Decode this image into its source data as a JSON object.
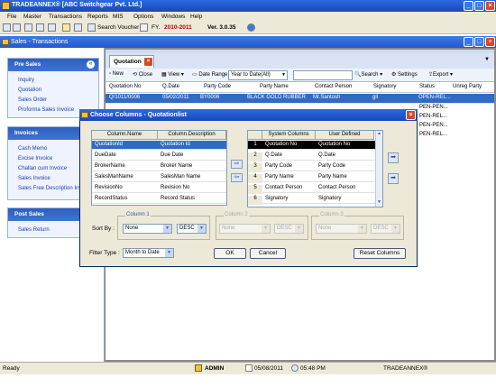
{
  "app": {
    "title": "TRADEANNEX® [ABC Switchgear Pvt. Ltd.]",
    "menu": [
      "File",
      "Master",
      "Transactions",
      "Reports",
      "MIS",
      "Options",
      "Windows",
      "Help"
    ],
    "toolbar": {
      "search_voucher": "Search Voucher",
      "fy": "FY.",
      "fy_value": "2010-2011",
      "version": "Ver. 3.0.35"
    }
  },
  "inner_window": {
    "title": "Sales - Transactions"
  },
  "sidebar": {
    "pre_sales": {
      "header": "Pre Sales",
      "items": [
        "Inquiry",
        "Quotation",
        "Sales Order",
        "Proforma Sales Invoice"
      ]
    },
    "invoices": {
      "header": "Invoices",
      "items": [
        "Cash Memo",
        "Excise Invoice",
        "Challan cum Invoice",
        "Sales Invoice",
        "Sales Free Description Inv"
      ]
    },
    "post_sales": {
      "header": "Post Sales",
      "items": [
        "Sales Return"
      ]
    }
  },
  "quotation": {
    "tab_label": "Quotation",
    "toolbar": {
      "new": "New",
      "close": "Close",
      "view": "View",
      "date_range": "Date Range",
      "date_range_value": "Year to Date(All)",
      "search": "Search",
      "settings": "Settings",
      "export": "Export"
    },
    "columns": [
      "Quotation No",
      "Q.Date",
      "Party Code",
      "Party Name",
      "Contact Person",
      "Signatory",
      "Status",
      "Unreg Party"
    ],
    "rows": [
      [
        "Q/1011/0006",
        "05/02/2011",
        "BY0006",
        "BLACK GOLD RUBBER",
        "Mr.Santosh",
        "gll",
        "OPEN-REL...",
        ""
      ],
      [
        "",
        "",
        "",
        "",
        "",
        "",
        "PEN-PEN...",
        ""
      ],
      [
        "",
        "",
        "",
        "",
        "",
        "",
        "PEN-REL...",
        ""
      ],
      [
        "",
        "",
        "",
        "",
        "",
        "",
        "PEN-PEN...",
        ""
      ],
      [
        "",
        "",
        "",
        "",
        "",
        "",
        "PEN-REL...",
        ""
      ]
    ]
  },
  "dialog": {
    "title": "Choose Columns - Quotationlist",
    "left_list": {
      "headers": [
        "Column.Name",
        "Column.Description"
      ],
      "rows": [
        [
          "QuotationId",
          "Quotation Id"
        ],
        [
          "DueDate",
          "Due Date"
        ],
        [
          "BrokerName",
          "Broker Name"
        ],
        [
          "SalesManName",
          "SalesMan Name"
        ],
        [
          "RevisionNo",
          "Revision No"
        ],
        [
          "RecordStatus",
          "Record Status"
        ]
      ]
    },
    "right_list": {
      "headers": [
        "",
        "System Columns",
        "User  Defined"
      ],
      "rows": [
        [
          "1",
          "Quotation No",
          "Quotation No"
        ],
        [
          "2",
          "Q.Date",
          "Q.Date"
        ],
        [
          "3",
          "Party Code",
          "Party Code"
        ],
        [
          "4",
          "Party Name",
          "Party Name"
        ],
        [
          "5",
          "Contact Person",
          "Contact Person"
        ],
        [
          "6",
          "Signatory",
          "Signatory"
        ]
      ]
    },
    "sort": {
      "label": "Sort By :",
      "groups": [
        {
          "label": "Column 1",
          "field": "None",
          "order": "DESC"
        },
        {
          "label": "Column 2",
          "field": "None",
          "order": "DESC"
        },
        {
          "label": "Column 3",
          "field": "None",
          "order": "DESC"
        }
      ]
    },
    "filter": {
      "label": "Filter Type :",
      "value": "Month to Date"
    },
    "buttons": {
      "ok": "OK",
      "cancel": "Cancel",
      "reset": "Reset Columns"
    }
  },
  "statusbar": {
    "ready": "Ready",
    "user": "ADMIN",
    "date": "05/08/2011",
    "time": "05:48 PM",
    "brand": "TRADEANNEX®"
  },
  "colors": {
    "title_blue": "#1848b8",
    "selected_row": "#316ac5",
    "sidebar_header": "#3d74d8"
  }
}
